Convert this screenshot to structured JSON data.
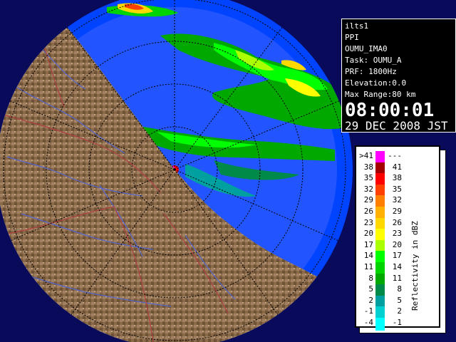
{
  "info": {
    "site": "ilts1",
    "product": "PPI",
    "volume": "OUMU_IMA0",
    "task": "Task: OUMU_A",
    "prf": "PRF: 1800Hz",
    "elevation": "Elevation:0.0",
    "max_range": "Max Range:80 km",
    "time": "08:00:01",
    "date": "29 DEC 2008 JST"
  },
  "legend": {
    "unit_label": "Reflectivity in dBZ",
    "bins": [
      {
        "lo": ">41",
        "hi": "---",
        "color": "#ff00ff"
      },
      {
        "lo": "38",
        "hi": "41",
        "color": "#a50000"
      },
      {
        "lo": "35",
        "hi": "38",
        "color": "#ff0000"
      },
      {
        "lo": "32",
        "hi": "35",
        "color": "#ff4000"
      },
      {
        "lo": "29",
        "hi": "32",
        "color": "#ff8000"
      },
      {
        "lo": "26",
        "hi": "29",
        "color": "#ffb000"
      },
      {
        "lo": "23",
        "hi": "26",
        "color": "#ffd800"
      },
      {
        "lo": "20",
        "hi": "23",
        "color": "#ffff00"
      },
      {
        "lo": "17",
        "hi": "20",
        "color": "#aaff00"
      },
      {
        "lo": "14",
        "hi": "17",
        "color": "#00ff00"
      },
      {
        "lo": "11",
        "hi": "14",
        "color": "#00d400"
      },
      {
        "lo": "8",
        "hi": "11",
        "color": "#00a800"
      },
      {
        "lo": "5",
        "hi": "8",
        "color": "#008a4a"
      },
      {
        "lo": "2",
        "hi": "5",
        "color": "#00a0a0"
      },
      {
        "lo": "-1",
        "hi": "2",
        "color": "#00d0d0"
      },
      {
        "lo": "-4",
        "hi": "-1",
        "color": "#00ffff"
      }
    ]
  },
  "colors": {
    "sea_outer": "#0044ff",
    "sea_inner": "#2255ff",
    "land": "#8a6a48",
    "river": "#5566cc",
    "boundary": "#b04040",
    "range_ring": "#000000"
  }
}
